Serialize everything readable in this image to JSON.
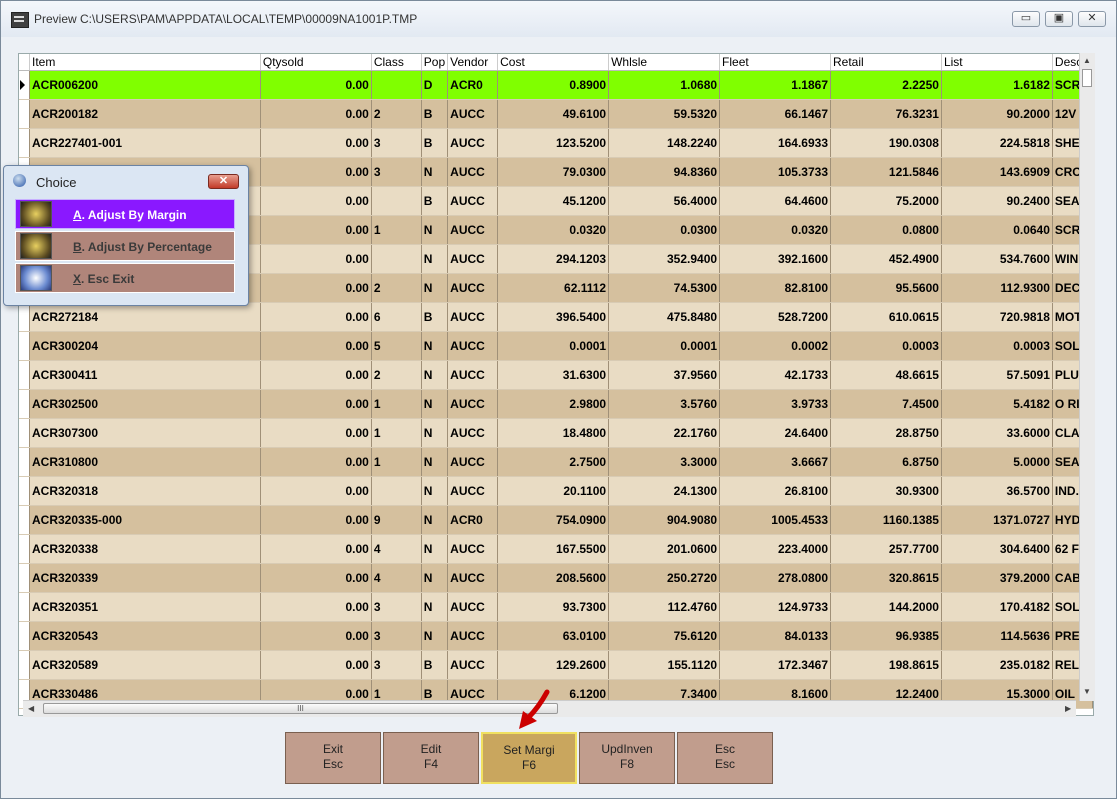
{
  "window": {
    "title": "Preview C:\\USERS\\PAM\\APPDATA\\LOCAL\\TEMP\\00009NA1001P.TMP",
    "minimize_glyph": "▭",
    "maximize_glyph": "▣",
    "close_glyph": "✕"
  },
  "grid": {
    "columns": [
      "Item",
      "Qtysold",
      "Class",
      "Pop",
      "Vendor",
      "Cost",
      "Whlsle",
      "Fleet",
      "Retail",
      "List",
      "Desc"
    ],
    "selected_row": 0,
    "rows": [
      [
        "ACR006200",
        "0.00",
        "",
        "D",
        "ACR0",
        "0.8900",
        "1.0680",
        "1.1867",
        "2.2250",
        "1.6182",
        "SCR"
      ],
      [
        "ACR200182",
        "0.00",
        "2",
        "B",
        "AUCC",
        "49.6100",
        "59.5320",
        "66.1467",
        "76.3231",
        "90.2000",
        "12V"
      ],
      [
        "ACR227401-001",
        "0.00",
        "3",
        "B",
        "AUCC",
        "123.5200",
        "148.2240",
        "164.6933",
        "190.0308",
        "224.5818",
        "SHE"
      ],
      [
        "",
        "0.00",
        "3",
        "N",
        "AUCC",
        "79.0300",
        "94.8360",
        "105.3733",
        "121.5846",
        "143.6909",
        "CRO"
      ],
      [
        "",
        "0.00",
        "",
        "B",
        "AUCC",
        "45.1200",
        "56.4000",
        "64.4600",
        "75.2000",
        "90.2400",
        "SEA"
      ],
      [
        "",
        "0.00",
        "1",
        "N",
        "AUCC",
        "0.0320",
        "0.0300",
        "0.0320",
        "0.0800",
        "0.0640",
        "SCR"
      ],
      [
        "",
        "0.00",
        "",
        "N",
        "AUCC",
        "294.1203",
        "352.9400",
        "392.1600",
        "452.4900",
        "534.7600",
        "WIN"
      ],
      [
        "",
        "0.00",
        "2",
        "N",
        "AUCC",
        "62.1112",
        "74.5300",
        "82.8100",
        "95.5600",
        "112.9300",
        "DEC"
      ],
      [
        "ACR272184",
        "0.00",
        "6",
        "B",
        "AUCC",
        "396.5400",
        "475.8480",
        "528.7200",
        "610.0615",
        "720.9818",
        "MOT"
      ],
      [
        "ACR300204",
        "0.00",
        "5",
        "N",
        "AUCC",
        "0.0001",
        "0.0001",
        "0.0002",
        "0.0003",
        "0.0003",
        "SOL"
      ],
      [
        "ACR300411",
        "0.00",
        "2",
        "N",
        "AUCC",
        "31.6300",
        "37.9560",
        "42.1733",
        "48.6615",
        "57.5091",
        "PLU"
      ],
      [
        "ACR302500",
        "0.00",
        "1",
        "N",
        "AUCC",
        "2.9800",
        "3.5760",
        "3.9733",
        "7.4500",
        "5.4182",
        "O RI"
      ],
      [
        "ACR307300",
        "0.00",
        "1",
        "N",
        "AUCC",
        "18.4800",
        "22.1760",
        "24.6400",
        "28.8750",
        "33.6000",
        "CLA"
      ],
      [
        "ACR310800",
        "0.00",
        "1",
        "N",
        "AUCC",
        "2.7500",
        "3.3000",
        "3.6667",
        "6.8750",
        "5.0000",
        "SEA"
      ],
      [
        "ACR320318",
        "0.00",
        "",
        "N",
        "AUCC",
        "20.1100",
        "24.1300",
        "26.8100",
        "30.9300",
        "36.5700",
        "IND."
      ],
      [
        "ACR320335-000",
        "0.00",
        "9",
        "N",
        "ACR0",
        "754.0900",
        "904.9080",
        "1005.4533",
        "1160.1385",
        "1371.0727",
        "HYD"
      ],
      [
        "ACR320338",
        "0.00",
        "4",
        "N",
        "AUCC",
        "167.5500",
        "201.0600",
        "223.4000",
        "257.7700",
        "304.6400",
        "62 F"
      ],
      [
        "ACR320339",
        "0.00",
        "4",
        "N",
        "AUCC",
        "208.5600",
        "250.2720",
        "278.0800",
        "320.8615",
        "379.2000",
        "CAB"
      ],
      [
        "ACR320351",
        "0.00",
        "3",
        "N",
        "AUCC",
        "93.7300",
        "112.4760",
        "124.9733",
        "144.2000",
        "170.4182",
        "SOL"
      ],
      [
        "ACR320543",
        "0.00",
        "3",
        "N",
        "AUCC",
        "63.0100",
        "75.6120",
        "84.0133",
        "96.9385",
        "114.5636",
        "PRE"
      ],
      [
        "ACR320589",
        "0.00",
        "3",
        "B",
        "AUCC",
        "129.2600",
        "155.1120",
        "172.3467",
        "198.8615",
        "235.0182",
        "REL"
      ],
      [
        "ACR330486",
        "0.00",
        "1",
        "B",
        "AUCC",
        "6.1200",
        "7.3400",
        "8.1600",
        "12.2400",
        "15.3000",
        "OIL"
      ]
    ]
  },
  "scrollbar": {
    "grip_glyph": "III"
  },
  "dialog": {
    "title": "Choice",
    "close_glyph": "✕",
    "options": [
      {
        "key": "A",
        "label": ". Adjust By Margin",
        "icon": "globe-icon"
      },
      {
        "key": "B",
        "label": ". Adjust By Percentage",
        "icon": "globe-icon"
      },
      {
        "key": "X",
        "label": ". Esc  Exit",
        "icon": "exit-icon"
      }
    ]
  },
  "function_keys": [
    {
      "line1": "Exit",
      "line2": "Esc"
    },
    {
      "line1": "Edit",
      "line2": "F4"
    },
    {
      "line1": "Set Margi",
      "line2": "F6"
    },
    {
      "line1": "UpdInven",
      "line2": "F8"
    },
    {
      "line1": "Esc",
      "line2": "Esc"
    }
  ],
  "colors": {
    "selected_row": "#80ff00",
    "row_light": "#e9dcc4",
    "row_dark": "#d5c09e",
    "active_choice": "#8a18ff",
    "annotation_arrow": "#cc0000"
  }
}
